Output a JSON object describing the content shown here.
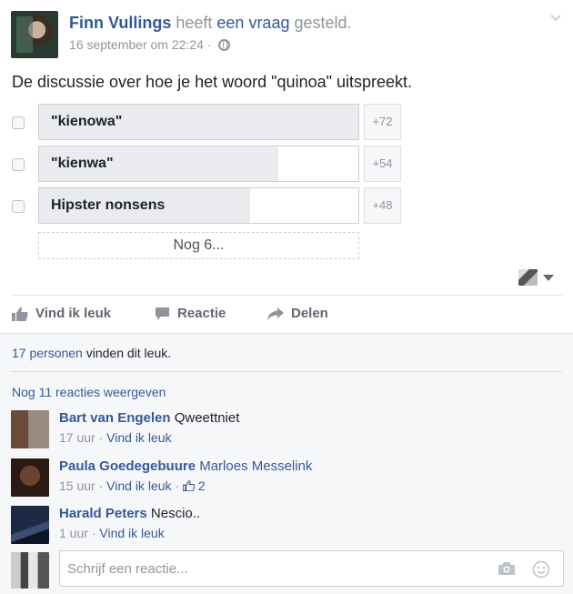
{
  "post": {
    "author": "Finn Vullings",
    "verb_pre": "heeft",
    "verb_link": "een vraag",
    "verb_post": "gesteld.",
    "timestamp": "16 september om 22:24",
    "meta_sep": "·",
    "question": "De discussie over hoe je het woord \"quinoa\" uitspreekt."
  },
  "poll": {
    "options": [
      {
        "label": "\"kienowa\"",
        "count": "+72",
        "fill_fraction": 1.0
      },
      {
        "label": "\"kienwa\"",
        "count": "+54",
        "fill_fraction": 0.75
      },
      {
        "label": "Hipster nonsens",
        "count": "+48",
        "fill_fraction": 0.66
      }
    ],
    "more_label": "Nog 6..."
  },
  "actions": {
    "like": "Vind ik leuk",
    "comment": "Reactie",
    "share": "Delen"
  },
  "feedback": {
    "likes_link": "17 personen",
    "likes_text": " vinden dit leuk.",
    "view_more": "Nog 11 reacties weergeven",
    "comments": [
      {
        "name": "Bart van Engelen",
        "text": "Qweettniet",
        "tag": "",
        "time": "17 uur",
        "like": "Vind ik leuk",
        "thumbs": ""
      },
      {
        "name": "Paula Goedegebuure",
        "text": "",
        "tag": "Marloes Messelink",
        "time": "15 uur",
        "like": "Vind ik leuk",
        "thumbs": "2"
      },
      {
        "name": "Harald Peters",
        "text": "Nescio..",
        "tag": "",
        "time": "1 uur",
        "like": "Vind ik leuk",
        "thumbs": ""
      }
    ],
    "dot": "·",
    "composer_placeholder": "Schrijf een reactie..."
  },
  "icons": {
    "audience": "audience-selector-icon",
    "globe": "globe-icon",
    "chevron": "chevron-down-icon",
    "like": "thumbs-up-icon",
    "comment": "speech-bubble-icon",
    "share": "share-arrow-icon",
    "camera": "camera-icon",
    "emoji": "smiley-icon"
  },
  "colors": {
    "link": "#365899",
    "muted": "#90949c",
    "bar_fill": "#e9ebee"
  }
}
